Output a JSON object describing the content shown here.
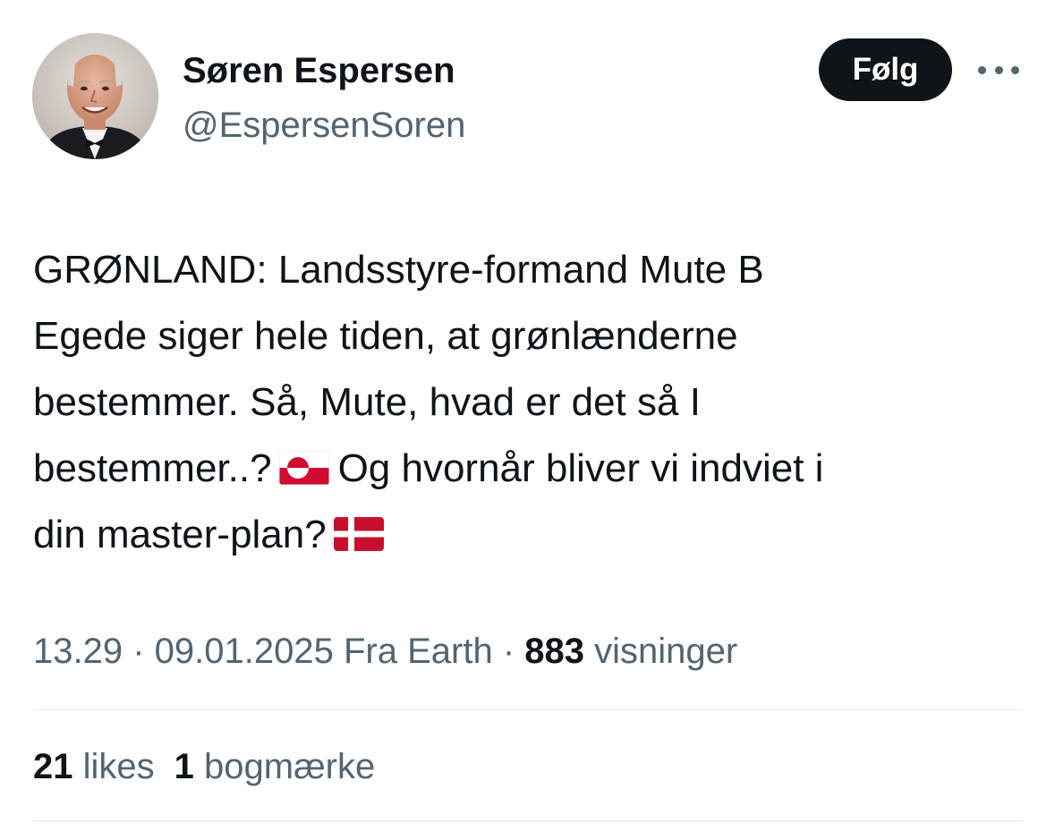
{
  "author": {
    "display_name": "Søren Espersen",
    "handle": "@EspersenSoren",
    "avatar_icon": "profile-photo"
  },
  "actions": {
    "follow_label": "Følg",
    "more_icon": "more-horizontal-icon"
  },
  "tweet": {
    "lines": [
      "GRØNLAND: Landsstyre-formand Mute B",
      "Egede siger hele tiden, at grønlænderne",
      "bestemmer. Så, Mute, hvad er det så I",
      "bestemmer..?",
      "Og hvornår bliver vi indviet i",
      "din master-plan?"
    ],
    "flags": [
      "greenland-flag-icon",
      "denmark-flag-icon"
    ]
  },
  "meta": {
    "time": "13.29",
    "separator": " · ",
    "date": "09.01.2025",
    "source": "Fra Earth",
    "views_count": "883",
    "views_label": "visninger"
  },
  "stats": {
    "likes_count": "21",
    "likes_label": "likes",
    "bookmarks_count": "1",
    "bookmarks_label": "bogmærke"
  },
  "colors": {
    "text_primary": "#0f1419",
    "text_secondary": "#536471",
    "divider": "#eff3f4",
    "follow_bg": "#0f1419",
    "follow_text": "#ffffff",
    "greenland_red": "#d00c33",
    "denmark_red": "#c8102e"
  }
}
